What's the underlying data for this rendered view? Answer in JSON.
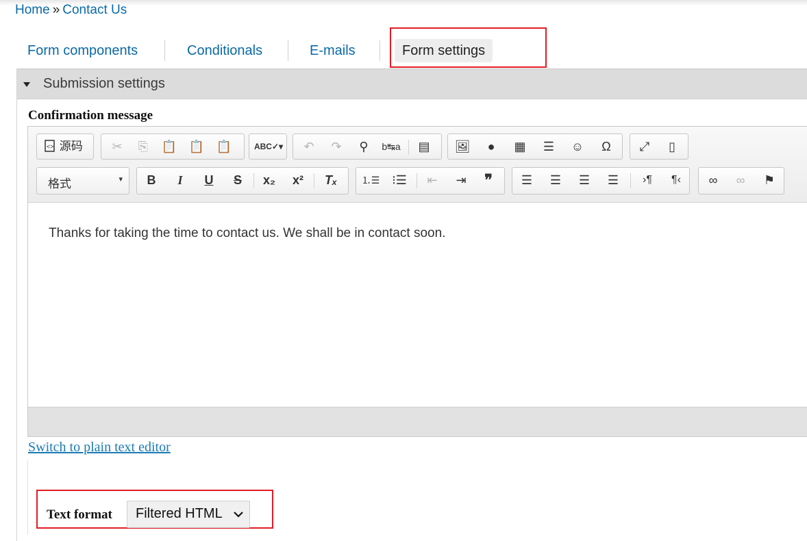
{
  "breadcrumb": {
    "home": "Home",
    "separator": "»",
    "current": "Contact Us"
  },
  "tabs": [
    {
      "label": "Form components"
    },
    {
      "label": "Conditionals"
    },
    {
      "label": "E-mails"
    },
    {
      "label": "Form settings",
      "active": true
    }
  ],
  "section": {
    "title": "Submission settings",
    "expanded": true
  },
  "confirmation": {
    "label": "Confirmation message"
  },
  "toolbar": {
    "source_label": "源码",
    "format_label": "格式",
    "icons_row1": [
      "source-icon",
      "cut-icon",
      "copy-icon",
      "paste-icon",
      "paste-text-icon",
      "paste-word-icon",
      "spellcheck-icon",
      "undo-icon",
      "redo-icon",
      "find-icon",
      "replace-icon",
      "select-all-icon",
      "image-icon",
      "flash-icon",
      "table-icon",
      "horizontal-rule-icon",
      "smiley-icon",
      "special-char-icon",
      "maximize-icon",
      "show-blocks-icon"
    ],
    "icons_row2": [
      "format-dropdown",
      "bold-icon",
      "italic-icon",
      "underline-icon",
      "strikethrough-icon",
      "subscript-icon",
      "superscript-icon",
      "remove-format-icon",
      "numbered-list-icon",
      "bulleted-list-icon",
      "outdent-icon",
      "indent-icon",
      "blockquote-icon",
      "align-left-icon",
      "align-center-icon",
      "align-right-icon",
      "justify-icon",
      "ltr-icon",
      "rtl-icon",
      "link-icon",
      "unlink-icon",
      "anchor-icon"
    ]
  },
  "editor": {
    "content": "Thanks for taking the time to contact us. We shall be in contact soon."
  },
  "switch_link": "Switch to plain text editor",
  "text_format": {
    "label": "Text format",
    "selected": "Filtered HTML"
  },
  "colors": {
    "link": "#0a69a8",
    "highlight": "#e21c24",
    "legend_bg": "#dcdcdc"
  }
}
